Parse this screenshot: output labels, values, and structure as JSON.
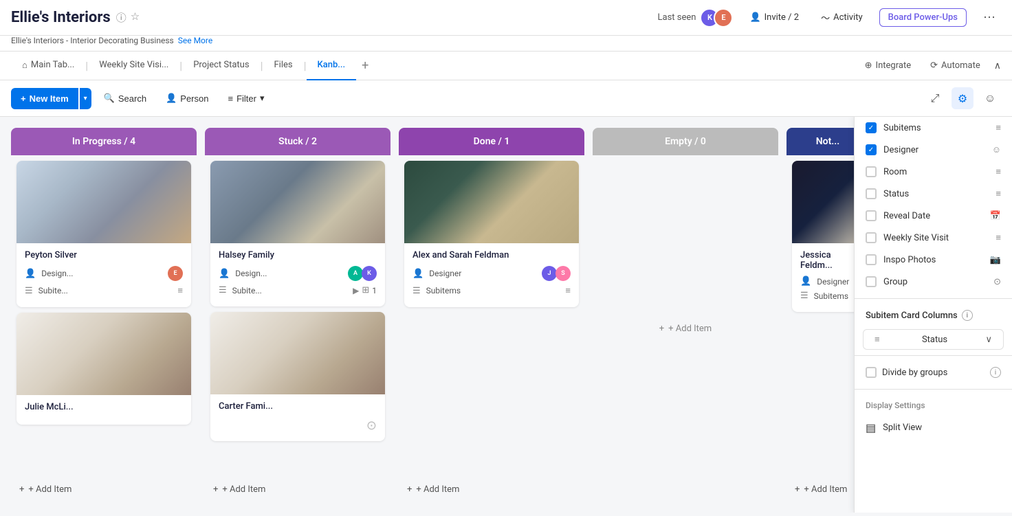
{
  "app": {
    "title": "Ellie's Interiors",
    "subtitle": "Ellie's Interiors - Interior Decorating Business",
    "see_more": "See More"
  },
  "header": {
    "last_seen_label": "Last seen",
    "invite_label": "Invite / 2",
    "activity_label": "Activity",
    "board_powerups_label": "Board Power-Ups",
    "more_icon": "⋯"
  },
  "tabs": {
    "items": [
      {
        "label": "Main Tab...",
        "active": false
      },
      {
        "label": "Weekly Site Visi...",
        "active": false
      },
      {
        "label": "Project Status",
        "active": false
      },
      {
        "label": "Files",
        "active": false
      },
      {
        "label": "Kanb...",
        "active": true
      }
    ],
    "add_label": "+",
    "integrate_label": "Integrate",
    "automate_label": "Automate"
  },
  "toolbar": {
    "new_item_label": "New Item",
    "search_label": "Search",
    "person_label": "Person",
    "filter_label": "Filter"
  },
  "columns": [
    {
      "id": "in-progress",
      "title": "In Progress / 4",
      "color": "#9b59b6",
      "cards": [
        {
          "title": "Peyton Silver",
          "designer_label": "Design...",
          "subitem_label": "Subite...",
          "has_image": true,
          "img_class": "img-kitchen"
        },
        {
          "title": "Julie McLi...",
          "has_image": true,
          "img_class": "img-room2",
          "partial": true
        }
      ],
      "add_label": "+ Add Item"
    },
    {
      "id": "stuck",
      "title": "Stuck / 2",
      "color": "#9b59b6",
      "cards": [
        {
          "title": "Halsey Family",
          "designer_label": "Design...",
          "subitem_label": "Subite...",
          "subitem_count": "1",
          "has_image": true,
          "img_class": "img-halsey"
        },
        {
          "title": "Carter Fami...",
          "has_image": true,
          "img_class": "img-room2",
          "partial": true
        }
      ],
      "add_label": "+ Add Item"
    },
    {
      "id": "done",
      "title": "Done / 1",
      "color": "#8e44ad",
      "cards": [
        {
          "title": "Alex and Sarah Feldman",
          "designer_label": "Designer",
          "subitem_label": "Subitems",
          "has_image": true,
          "img_class": "img-feldman"
        }
      ],
      "add_label": "+ Add Item"
    },
    {
      "id": "empty",
      "title": "Empty / 0",
      "color": "#bbb",
      "cards": [],
      "add_label": "+ Add Item"
    },
    {
      "id": "not",
      "title": "Not...",
      "color": "#2c3e8c",
      "cards": [
        {
          "title": "Jessica Feldm...",
          "designer_label": "Designer",
          "subitem_label": "Subitems",
          "has_image": true,
          "img_class": "img-jessica"
        }
      ],
      "add_label": "+ Add Item"
    }
  ],
  "settings_panel": {
    "columns_label": "Subitems",
    "items": [
      {
        "label": "Subitems",
        "checked": true
      },
      {
        "label": "Designer",
        "checked": true
      },
      {
        "label": "Room",
        "checked": false
      },
      {
        "label": "Status",
        "checked": false
      },
      {
        "label": "Reveal Date",
        "checked": false
      },
      {
        "label": "Weekly Site Visit",
        "checked": false
      },
      {
        "label": "Inspo Photos",
        "checked": false
      },
      {
        "label": "Group",
        "checked": false
      }
    ],
    "subitem_card_columns_label": "Subitem Card Columns",
    "status_dropdown_label": "Status",
    "divide_by_groups_label": "Divide by groups",
    "display_settings_label": "Display Settings",
    "split_view_label": "Split View"
  }
}
